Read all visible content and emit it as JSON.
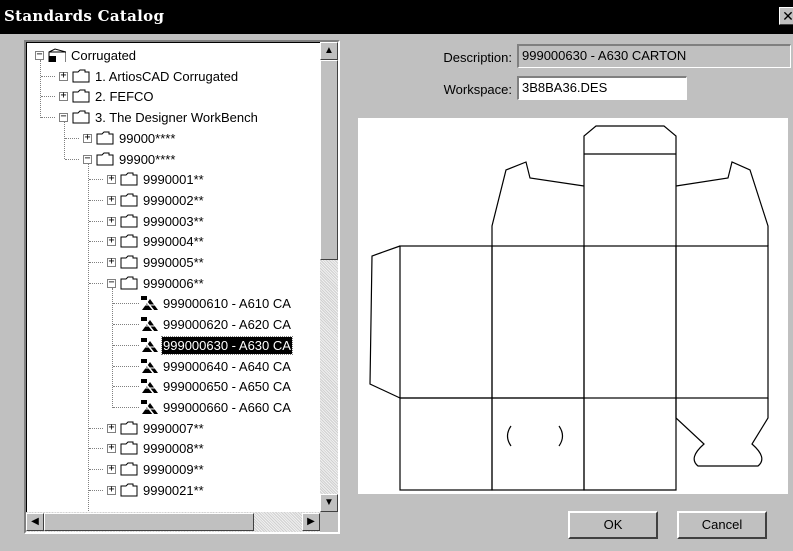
{
  "dialog": {
    "title": "Standards Catalog",
    "close_glyph": "✕"
  },
  "tree": {
    "root": "Corrugated",
    "level1": [
      "1. ArtiosCAD Corrugated",
      "2. FEFCO",
      "3. The Designer WorkBench"
    ],
    "level2": [
      "99000****",
      "99900****"
    ],
    "groups_before": [
      "9990001**",
      "9990002**",
      "9990003**",
      "9990004**",
      "9990005**",
      "9990006**"
    ],
    "designs": [
      "999000610 - A610 CA",
      "999000620 - A620 CA",
      "999000630 - A630 CA",
      "999000640 - A640 CA",
      "999000650 - A650 CA",
      "999000660 - A660 CA"
    ],
    "selected_design_index": 2,
    "groups_after": [
      "9990007**",
      "9990008**",
      "9990009**",
      "9990021**"
    ],
    "expand_glyph": "+",
    "collapse_glyph": "−"
  },
  "scrollbar": {
    "up": "▲",
    "down": "▼",
    "left": "◀",
    "right": "▶"
  },
  "details": {
    "description_label": "Description:",
    "description_value": "999000630 - A630 CARTON",
    "workspace_label": "Workspace:",
    "workspace_value": "3B8BA36.DES"
  },
  "buttons": {
    "ok": "OK",
    "cancel": "Cancel"
  },
  "icons": {
    "root": "corrugated-catalog-icon",
    "folder": "folder-icon",
    "design": "design-file-icon"
  },
  "colors": {
    "title_bar": "#000000",
    "selection": "#000000",
    "dialog_bg": "#c0c0c0"
  }
}
